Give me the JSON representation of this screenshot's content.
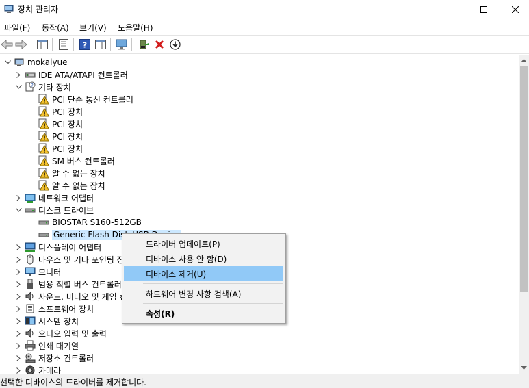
{
  "window": {
    "title": "장치 관리자"
  },
  "menu": [
    "파일(F)",
    "동작(A)",
    "보기(V)",
    "도움말(H)"
  ],
  "tree": {
    "root": "mokaiyue",
    "categories": {
      "ide": "IDE ATA/ATAPI 컨트롤러",
      "other": "기타 장치",
      "network": "네트워크 어댑터",
      "disk": "디스크 드라이브",
      "display": "디스플레이 어댑터",
      "mouse": "마우스 및 기타 포인팅 장치",
      "monitor": "모니터",
      "usb": "범용 직렬 버스 컨트롤러",
      "sound": "사운드, 비디오 및 게임 컨트롤러",
      "software": "소프트웨어 장치",
      "system": "시스템 장치",
      "audio": "오디오 입력 및 출력",
      "print": "인쇄 대기열",
      "storage": "저장소 컨트롤러",
      "camera": "카메라"
    },
    "other_devices": [
      "PCI 단순 통신 컨트롤러",
      "PCI 장치",
      "PCI 장치",
      "PCI 장치",
      "PCI 장치",
      "SM 버스 컨트롤러",
      "알 수 없는 장치",
      "알 수 없는 장치"
    ],
    "disk_devices": [
      "BIOSTAR S160-512GB",
      "Generic Flash Disk USB Device"
    ]
  },
  "context_menu": {
    "update": "드라이버 업데이트(P)",
    "disable": "디바이스 사용 안 함(D)",
    "uninstall": "디바이스 제거(U)",
    "scan": "하드웨어 변경 사항 검색(A)",
    "properties": "속성(R)"
  },
  "status": "선택한 디바이스의 드라이버를 제거합니다.",
  "colors": {
    "selection": "#cce8ff",
    "menu_highlight": "#91c9f7",
    "warning": "#f3c12d",
    "remove": "#d21b1b"
  }
}
